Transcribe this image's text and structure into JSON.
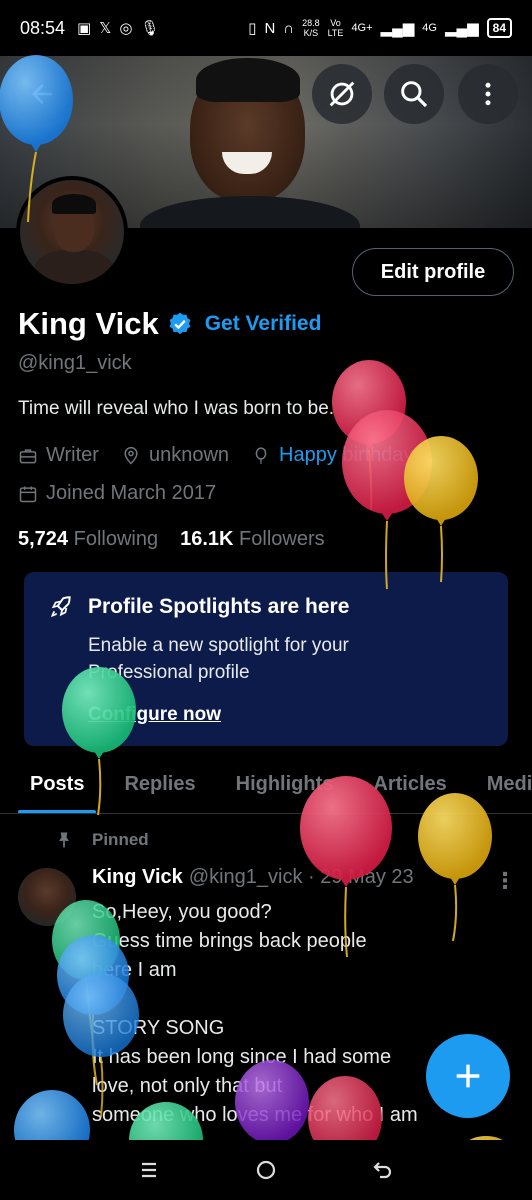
{
  "status_bar": {
    "time": "08:54",
    "net_speed_top": "28.8",
    "net_speed_bottom": "K/S",
    "volte_top": "Vo",
    "volte_bottom": "LTE",
    "network_1": "4G+",
    "network_2": "4G",
    "battery": "84"
  },
  "banner": {
    "back_icon": "arrow-left-icon",
    "grok_icon": "grok-slash-icon",
    "search_icon": "search-icon",
    "more_icon": "more-vertical-icon"
  },
  "profile": {
    "edit_label": "Edit profile",
    "display_name": "King Vick",
    "get_verified": "Get Verified",
    "handle": "@king1_vick",
    "bio": "Time will reveal who I was born to be.",
    "profession": "Writer",
    "location": "unknown",
    "birthday_label": "Happy birthday!",
    "joined": "Joined March 2017",
    "following_count": "5,724",
    "following_label": "Following",
    "followers_count": "16.1K",
    "followers_label": "Followers"
  },
  "spotlight": {
    "title": "Profile Spotlights are here",
    "body": "Enable a new spotlight for your Professional profile",
    "link": "Configure now"
  },
  "tabs": [
    "Posts",
    "Replies",
    "Highlights",
    "Articles",
    "Media"
  ],
  "tweet": {
    "pinned_label": "Pinned",
    "name": "King Vick",
    "handle_date": "@king1_vick · 29 May 23",
    "lines": [
      "So,Heey, you good?",
      "Guess time brings back people",
      "here I am",
      "",
      "STORY SONG",
      "It has been long since I had some",
      "love, not only that but",
      "someone who loves me for who I am"
    ]
  },
  "fab_icon": "plus-icon",
  "nav": {
    "recents_icon": "menu-lines-icon",
    "home_icon": "circle-home-icon",
    "back_icon": "back-arrow-icon"
  },
  "colors": {
    "accent": "#1d9bf0",
    "spotlight_bg": "#0c1b4a",
    "muted": "#71767b",
    "balloon_red": "#e8385a",
    "balloon_yellow": "#e5b820",
    "balloon_green": "#2fd491",
    "balloon_blue": "#2196f3",
    "balloon_purple": "#8e2bd6"
  }
}
